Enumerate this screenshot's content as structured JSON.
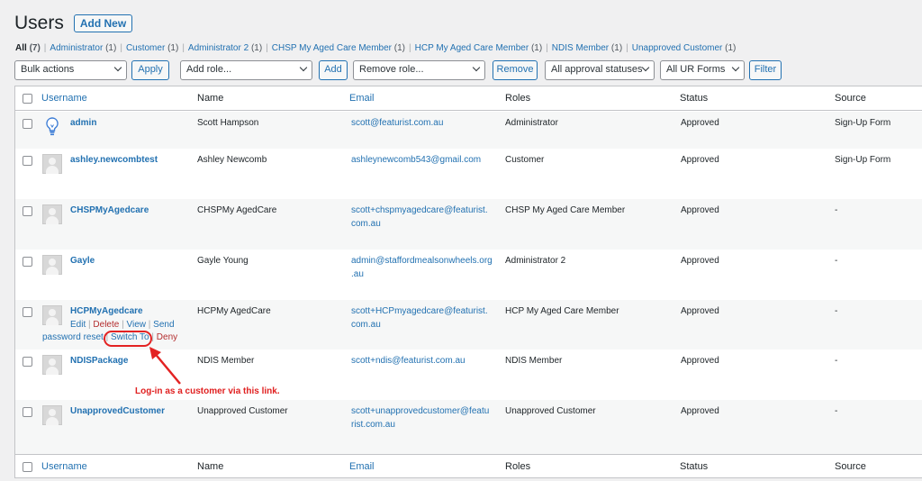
{
  "page": {
    "title": "Users",
    "add_new": "Add New"
  },
  "filters": [
    {
      "label": "All",
      "count": "(7)",
      "current": true
    },
    {
      "label": "Administrator",
      "count": "(1)"
    },
    {
      "label": "Customer",
      "count": "(1)"
    },
    {
      "label": "Administrator 2",
      "count": "(1)"
    },
    {
      "label": "CHSP My Aged Care Member",
      "count": "(1)"
    },
    {
      "label": "HCP My Aged Care Member",
      "count": "(1)"
    },
    {
      "label": "NDIS Member",
      "count": "(1)"
    },
    {
      "label": "Unapproved Customer",
      "count": "(1)"
    }
  ],
  "controls": {
    "bulk_actions": "Bulk actions",
    "apply": "Apply",
    "add_role": "Add role...",
    "add": "Add",
    "remove_role": "Remove role...",
    "remove": "Remove",
    "approval_statuses": "All approval statuses",
    "ur_forms": "All UR Forms",
    "filter": "Filter"
  },
  "columns": {
    "username": "Username",
    "name": "Name",
    "email": "Email",
    "roles": "Roles",
    "status": "Status",
    "source": "Source"
  },
  "users": [
    {
      "username": "admin",
      "name": "Scott Hampson",
      "email": [
        "scott@featurist.com.au"
      ],
      "role": "Administrator",
      "status": "Approved",
      "source": "Sign-Up Form",
      "avatar": "lightbulb-icon"
    },
    {
      "username": "ashley.newcombtest",
      "name": "Ashley Newcomb",
      "email": [
        "ashleynewcomb543@gmail.com"
      ],
      "role": "Customer",
      "status": "Approved",
      "source": "Sign-Up Form",
      "avatar": "default-avatar-icon"
    },
    {
      "username": "CHSPMyAgedcare",
      "name": "CHSPMy AgedCare",
      "email": [
        "scott+chspmyagedcare@featurist.",
        "com.au"
      ],
      "role": "CHSP My Aged Care Member",
      "status": "Approved",
      "source": "-",
      "avatar": "default-avatar-icon"
    },
    {
      "username": "Gayle",
      "name": "Gayle Young",
      "email": [
        "admin@staffordmealsonwheels.org",
        ".au"
      ],
      "role": "Administrator 2",
      "status": "Approved",
      "source": "-",
      "avatar": "default-avatar-icon"
    },
    {
      "username": "HCPMyAgedcare",
      "name": "HCPMy AgedCare",
      "email": [
        "scott+HCPmyagedcare@featurist.",
        "com.au"
      ],
      "role": "HCP My Aged Care Member",
      "status": "Approved",
      "source": "-",
      "avatar": "default-avatar-icon"
    },
    {
      "username": "NDISPackage",
      "name": "NDIS Member",
      "email": [
        "scott+ndis@featurist.com.au"
      ],
      "role": "NDIS Member",
      "status": "Approved",
      "source": "-",
      "avatar": "default-avatar-icon"
    },
    {
      "username": "UnapprovedCustomer",
      "name": "Unapproved Customer",
      "email": [
        "scott+unapprovedcustomer@featu",
        "rist.com.au"
      ],
      "role": "Unapproved Customer",
      "status": "Approved",
      "source": "-",
      "avatar": "default-avatar-icon"
    }
  ],
  "row_actions": {
    "edit": "Edit",
    "delete": "Delete",
    "view": "View",
    "send": "Send",
    "password_reset": "password reset",
    "switch_to": "Switch To",
    "deny": "Deny",
    "sep": "|"
  },
  "annotation": {
    "text": "Log-in as a customer via this link.",
    "color": "#e02020"
  },
  "colors": {
    "link": "#2271b1",
    "danger": "#b32d2e",
    "background": "#f0f0f1",
    "annotation": "#e32222"
  }
}
